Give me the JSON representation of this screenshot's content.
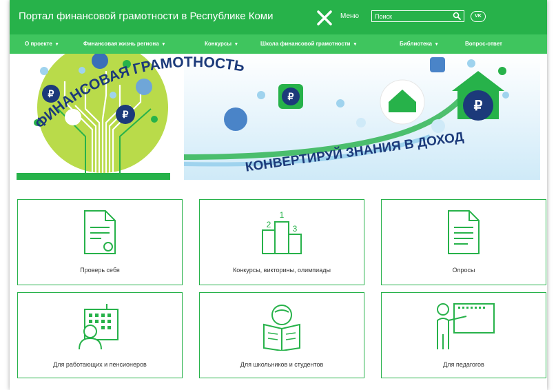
{
  "header": {
    "site_title": "Портал финансовой грамотности в Республике Коми",
    "menu_label": "Меню",
    "search_placeholder": "Поиск",
    "vk_label": "VK"
  },
  "nav": {
    "items": [
      {
        "label": "О проекте",
        "dropdown": true
      },
      {
        "label": "Финансовая жизнь региона",
        "dropdown": true
      },
      {
        "label": "Конкурсы",
        "dropdown": true
      },
      {
        "label": "Школа финансовой грамотности",
        "dropdown": true
      },
      {
        "label": "Библиотека",
        "dropdown": true
      },
      {
        "label": "Вопрос-ответ",
        "dropdown": false
      }
    ]
  },
  "banner": {
    "arc_text": "ФИНАНСОВАЯ ГРАМОТНОСТЬ!",
    "slogan": "КОНВЕРТИРУЙ ЗНАНИЯ В ДОХОД",
    "currency_symbol": "₽"
  },
  "tiles": [
    {
      "label": "Проверь себя",
      "icon": "certificate-document-icon"
    },
    {
      "label": "Конкурсы, викторины, олимпиады",
      "icon": "podium-icon",
      "podium_numbers": [
        "1",
        "2",
        "3"
      ]
    },
    {
      "label": "Опросы",
      "icon": "survey-document-icon"
    },
    {
      "label": "Для работающих и пенсионеров",
      "icon": "worker-building-icon"
    },
    {
      "label": "Для школьников и студентов",
      "icon": "student-reading-icon"
    },
    {
      "label": "Для педагогов",
      "icon": "teacher-board-icon"
    }
  ],
  "colors": {
    "brand_green": "#27b24a",
    "nav_green": "#3fc55e",
    "navy": "#1c3a7a",
    "light_blue": "#9fd3ee"
  }
}
